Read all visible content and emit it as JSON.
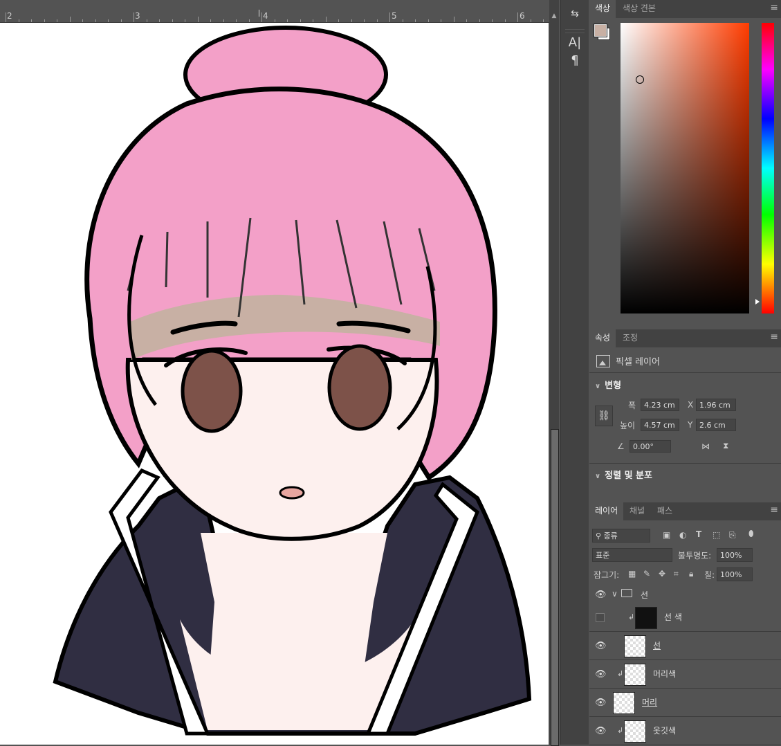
{
  "ruler": {
    "labels": [
      "2",
      "3",
      "4",
      "5",
      "6"
    ]
  },
  "tools": {
    "type_icon": "A|",
    "paragraph_icon": "¶"
  },
  "color_panel": {
    "tabs": [
      "색상",
      "색상 견본"
    ],
    "foreground_color": "#c8b0a4",
    "background_color": "#ffffff"
  },
  "properties": {
    "tabs": [
      "속성",
      "조정"
    ],
    "layer_type": "픽셀 레이어",
    "transform_title": "변형",
    "width_label": "폭",
    "width_value": "4.23 cm",
    "height_label": "높이",
    "height_value": "4.57 cm",
    "x_label": "X",
    "x_value": "1.96 cm",
    "y_label": "Y",
    "y_value": "2.6 cm",
    "angle_value": "0.00°",
    "align_title": "정렬 및 분포"
  },
  "layers": {
    "tabs": [
      "레이어",
      "채널",
      "패스"
    ],
    "filter_value": "종류",
    "blend_mode": "표준",
    "opacity_label": "불투명도:",
    "opacity_value": "100%",
    "lock_label": "잠그기:",
    "fill_label": "칠:",
    "fill_value": "100%",
    "items": [
      {
        "name": "선",
        "kind": "group"
      },
      {
        "name": "선 색"
      },
      {
        "name": "선"
      },
      {
        "name": "머리색"
      },
      {
        "name": "머리"
      },
      {
        "name": "옷깃색"
      }
    ]
  }
}
